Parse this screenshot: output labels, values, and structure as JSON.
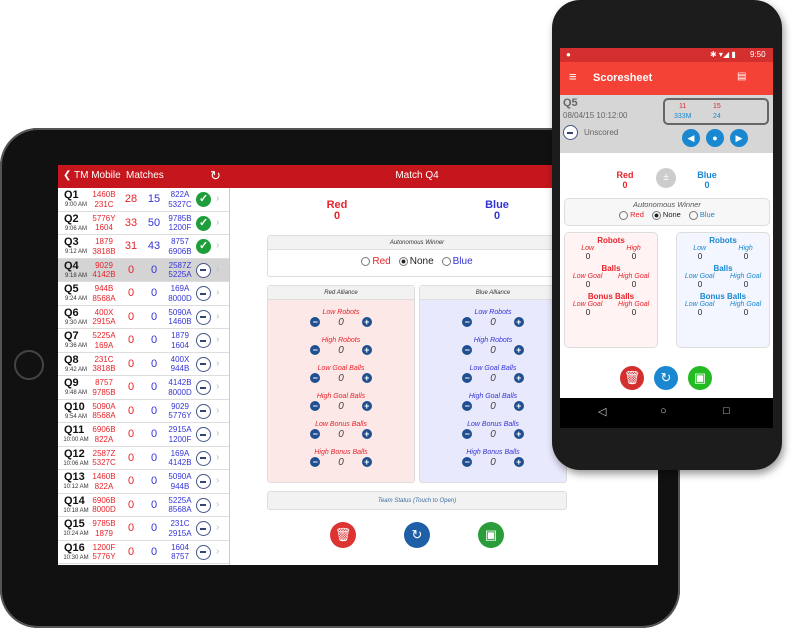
{
  "tablet": {
    "back_label": "TM Mobile",
    "list_title": "Matches",
    "match_title": "Match Q4",
    "red_label": "Red",
    "red_score": "0",
    "blue_label": "Blue",
    "blue_score": "0",
    "auto_title": "Autonomous Winner",
    "auto_options": [
      "Red",
      "None",
      "Blue"
    ],
    "auto_selected": "None",
    "red_alliance": "Red Alliance",
    "blue_alliance": "Blue Alliance",
    "counters": [
      {
        "label": "Low Robots",
        "red": "0",
        "blue": "0"
      },
      {
        "label": "High Robots",
        "red": "0",
        "blue": "0"
      },
      {
        "label": "Low Goal Balls",
        "red": "0",
        "blue": "0"
      },
      {
        "label": "High Goal Balls",
        "red": "0",
        "blue": "0"
      },
      {
        "label": "Low Bonus Balls",
        "red": "0",
        "blue": "0"
      },
      {
        "label": "High Bonus Balls",
        "red": "0",
        "blue": "0"
      }
    ],
    "team_status": "Team Status (Touch to Open)",
    "matches": [
      {
        "q": "Q1",
        "time": "9:00 AM",
        "red": [
          "1460B",
          "231C"
        ],
        "rs": "28",
        "bs": "15",
        "blue": [
          "822A",
          "5327C"
        ],
        "status": "scored"
      },
      {
        "q": "Q2",
        "time": "9:06 AM",
        "red": [
          "5776Y",
          "1604"
        ],
        "rs": "33",
        "bs": "50",
        "blue": [
          "9785B",
          "1200F"
        ],
        "status": "scored"
      },
      {
        "q": "Q3",
        "time": "9:12 AM",
        "red": [
          "1879",
          "3818B"
        ],
        "rs": "31",
        "bs": "43",
        "blue": [
          "8757",
          "6906B"
        ],
        "status": "scored"
      },
      {
        "q": "Q4",
        "time": "9:18 AM",
        "red": [
          "9029",
          "4142B"
        ],
        "rs": "0",
        "bs": "0",
        "blue": [
          "2587Z",
          "5225A"
        ],
        "status": "unscored",
        "selected": true
      },
      {
        "q": "Q5",
        "time": "9:24 AM",
        "red": [
          "944B",
          "8568A"
        ],
        "rs": "0",
        "bs": "0",
        "blue": [
          "169A",
          "8000D"
        ],
        "status": "unscored"
      },
      {
        "q": "Q6",
        "time": "9:30 AM",
        "red": [
          "400X",
          "2915A"
        ],
        "rs": "0",
        "bs": "0",
        "blue": [
          "5090A",
          "1460B"
        ],
        "status": "unscored"
      },
      {
        "q": "Q7",
        "time": "9:36 AM",
        "red": [
          "5225A",
          "169A"
        ],
        "rs": "0",
        "bs": "0",
        "blue": [
          "1879",
          "1604"
        ],
        "status": "unscored"
      },
      {
        "q": "Q8",
        "time": "9:42 AM",
        "red": [
          "231C",
          "3818B"
        ],
        "rs": "0",
        "bs": "0",
        "blue": [
          "400X",
          "944B"
        ],
        "status": "unscored"
      },
      {
        "q": "Q9",
        "time": "9:48 AM",
        "red": [
          "8757",
          "9785B"
        ],
        "rs": "0",
        "bs": "0",
        "blue": [
          "4142B",
          "8000D"
        ],
        "status": "unscored"
      },
      {
        "q": "Q10",
        "time": "9:54 AM",
        "red": [
          "5090A",
          "8568A"
        ],
        "rs": "0",
        "bs": "0",
        "blue": [
          "9029",
          "5776Y"
        ],
        "status": "unscored"
      },
      {
        "q": "Q11",
        "time": "10:00 AM",
        "red": [
          "6906B",
          "822A"
        ],
        "rs": "0",
        "bs": "0",
        "blue": [
          "2915A",
          "1200F"
        ],
        "status": "unscored"
      },
      {
        "q": "Q12",
        "time": "10:06 AM",
        "red": [
          "2587Z",
          "5327C"
        ],
        "rs": "0",
        "bs": "0",
        "blue": [
          "169A",
          "4142B"
        ],
        "status": "unscored"
      },
      {
        "q": "Q13",
        "time": "10:12 AM",
        "red": [
          "1460B",
          "822A"
        ],
        "rs": "0",
        "bs": "0",
        "blue": [
          "5090A",
          "944B"
        ],
        "status": "unscored"
      },
      {
        "q": "Q14",
        "time": "10:18 AM",
        "red": [
          "6906B",
          "8000D"
        ],
        "rs": "0",
        "bs": "0",
        "blue": [
          "5225A",
          "8568A"
        ],
        "status": "unscored"
      },
      {
        "q": "Q15",
        "time": "10:24 AM",
        "red": [
          "9785B",
          "1879"
        ],
        "rs": "0",
        "bs": "0",
        "blue": [
          "231C",
          "2915A"
        ],
        "status": "unscored"
      },
      {
        "q": "Q16",
        "time": "10:30 AM",
        "red": [
          "1200F",
          "5776Y"
        ],
        "rs": "0",
        "bs": "0",
        "blue": [
          "1604",
          "8757"
        ],
        "status": "unscored"
      }
    ]
  },
  "phone": {
    "clock": "9:50",
    "title": "Scoresheet",
    "match": "Q5",
    "datetime": "08/04/15 10:12:00",
    "status": "Unscored",
    "mini": {
      "red_score": "11",
      "blue_score": "15",
      "red_team": "333M",
      "blue_team": "24"
    },
    "red_label": "Red",
    "red_score": "0",
    "blue_label": "Blue",
    "blue_score": "0",
    "auto_title": "Autonomous Winner",
    "auto_options": [
      "Red",
      "None",
      "Blue"
    ],
    "auto_selected": "None",
    "sections": [
      {
        "title": "Robots",
        "a": "Low",
        "b": "High"
      },
      {
        "title": "Balls",
        "a": "Low Goal",
        "b": "High Goal"
      },
      {
        "title": "Bonus Balls",
        "a": "Low Goal",
        "b": "High Goal"
      }
    ],
    "values": "0"
  },
  "colors": {
    "red": "#e8232a",
    "blue": "#3434d6",
    "header": "#c4161c",
    "android_red": "#f44336",
    "android_blue": "#1a88d0"
  }
}
